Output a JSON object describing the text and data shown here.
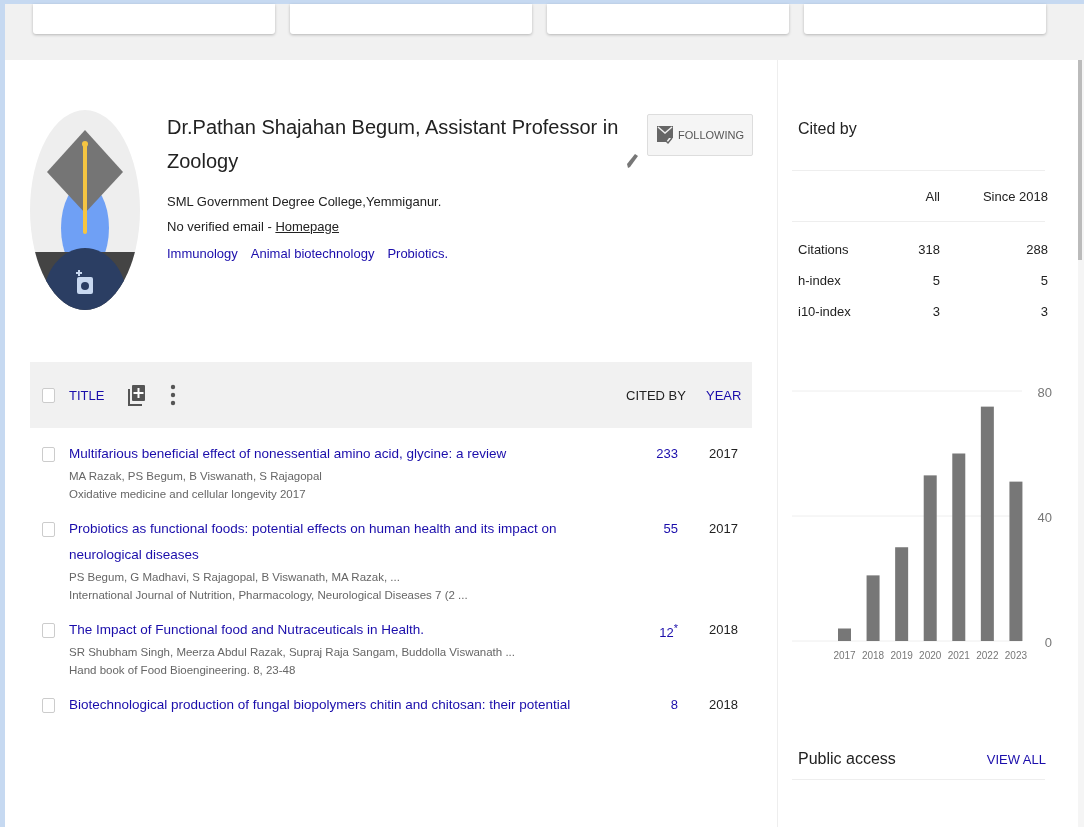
{
  "top_cards": [
    {
      "kind": "card"
    },
    {
      "kind": "card"
    },
    {
      "kind": "card"
    },
    {
      "kind": "card"
    }
  ],
  "profile": {
    "name": "Dr.Pathan Shajahan Begum, Assistant Professor in Zoology",
    "follow_button": "FOLLOWING",
    "affiliation": "SML Government Degree College,Yemmiganur.",
    "email_text": "No verified email - ",
    "homepage_link": "Homepage",
    "interests": [
      "Immunology",
      "Animal biotechnology",
      "Probiotics."
    ]
  },
  "articles_table": {
    "header": {
      "checked": false,
      "title": "TITLE",
      "cited_by": "CITED BY",
      "year": "YEAR"
    },
    "rows": [
      {
        "checked": false,
        "title": "Multifarious beneficial effect of nonessential amino acid, glycine: a review",
        "authors": "MA Razak, PS Begum, B Viswanath, S Rajagopal",
        "venue": "Oxidative medicine and cellular longevity 2017",
        "cited_by": "233",
        "year": "2017"
      },
      {
        "checked": false,
        "title": "Probiotics as functional foods: potential effects on human health and its impact on neurological diseases",
        "authors": "PS Begum, G Madhavi, S Rajagopal, B Viswanath, MA Razak, ...",
        "venue": "International Journal of Nutrition, Pharmacology, Neurological Diseases 7 (2 ...",
        "cited_by": "55",
        "year": "2017"
      },
      {
        "checked": false,
        "title": "The Impact of Functional food and Nutraceuticals in Health.",
        "authors": "SR Shubham Singh, Meerza Abdul Razak, Supraj Raja Sangam, Buddolla Viswanath ...",
        "venue": "Hand book of Food Bioengineering. 8, 23-48",
        "cited_by": "12$^{*}$",
        "year": "2018"
      },
      {
        "checked": false,
        "title": "Biotechnological production of fungal biopolymers chitin and chitosan: their potential",
        "cited_by": "8",
        "year": "2018"
      }
    ]
  },
  "cited_by": {
    "title": "Cited by",
    "columns": [
      "All",
      "Since 2018"
    ],
    "rows": [
      {
        "label": "Citations",
        "all": "318",
        "since": "288"
      },
      {
        "label": "h-index",
        "all": "5",
        "since": "5"
      },
      {
        "label": "i10-index",
        "all": "3",
        "since": "3"
      }
    ],
    "chart_data": {
      "type": "bar",
      "categories": [
        "2017",
        "2018",
        "2019",
        "2020",
        "2021",
        "2022",
        "2023"
      ],
      "values": [
        4,
        21,
        30,
        53,
        60,
        75,
        51
      ],
      "ylim": [
        0,
        80
      ],
      "yticks": [
        0,
        40,
        80
      ]
    }
  },
  "public_access": {
    "title": "Public access",
    "link": "VIEW ALL"
  }
}
